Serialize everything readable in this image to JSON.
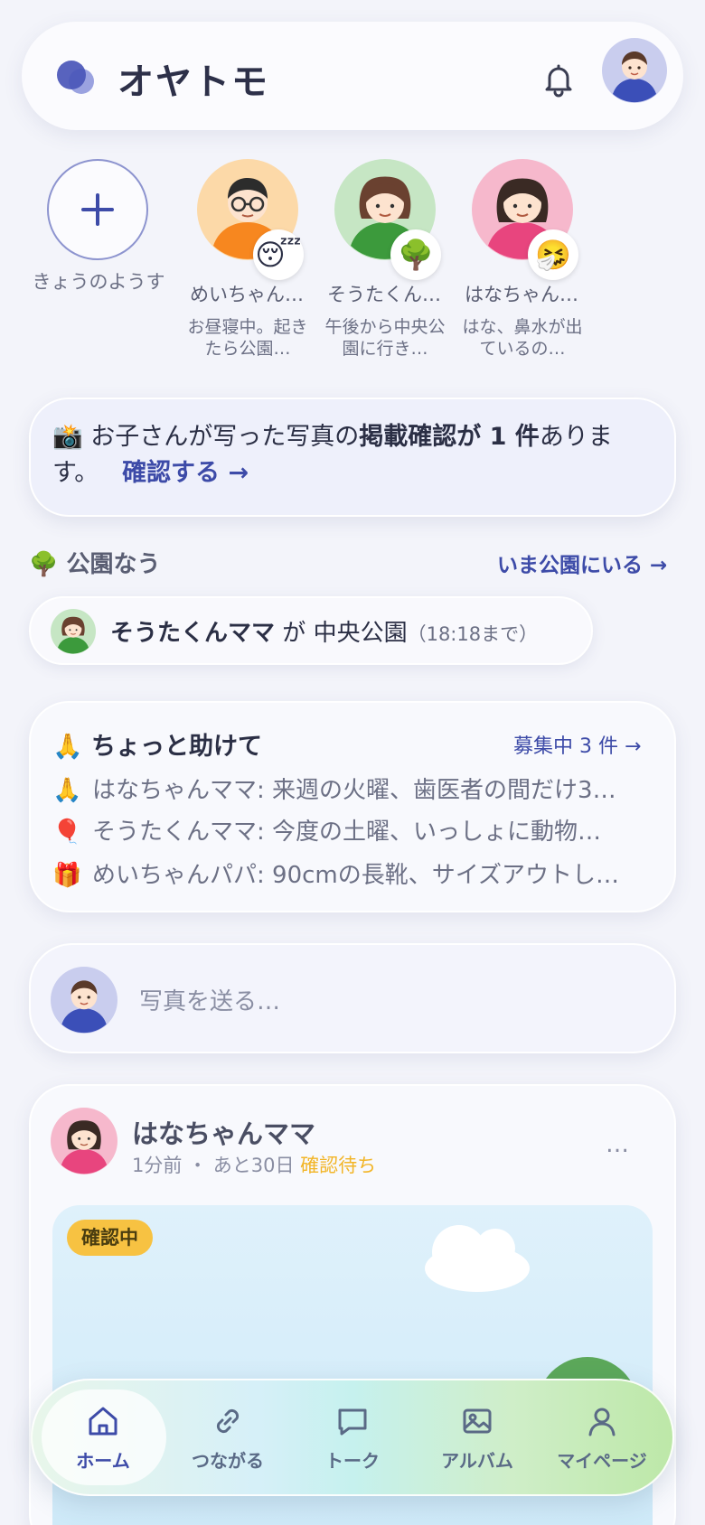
{
  "app": {
    "title": "オヤトモ",
    "accent": "#3d4ba8"
  },
  "header": {
    "bell_icon": "bell-icon",
    "avatar_icon": "user-avatar"
  },
  "stories": {
    "add_label": "きょうのようす",
    "items": [
      {
        "name": "めいちゃん…",
        "status": "😴",
        "note": "お昼寝中。起きたら公園…"
      },
      {
        "name": "そうたくん…",
        "status": "🌳",
        "note": "午後から中央公園に行き…"
      },
      {
        "name": "はなちゃん…",
        "status": "🤧",
        "note": "はな、鼻水が出ているの…"
      }
    ]
  },
  "banner": {
    "icon": "📸",
    "text_before": "お子さんが写った写真の",
    "text_bold": "掲載確認が 1 件",
    "text_after": "あります。",
    "link": "確認する →"
  },
  "park": {
    "icon": "🌳",
    "title": "公園なう",
    "link": "いま公園にいる →",
    "who": "そうたくんママ",
    "particle": "が",
    "place": "中央公園",
    "until": "（18:18まで）"
  },
  "help": {
    "icon": "🙏",
    "title": "ちょっと助けて",
    "count": "募集中 3 件 →",
    "items": [
      {
        "emoji": "🙏",
        "text": "はなちゃんママ: 来週の火曜、歯医者の間だけ3…"
      },
      {
        "emoji": "🎈",
        "text": "そうたくんママ: 今度の土曜、いっしょに動物…"
      },
      {
        "emoji": "🎁",
        "text": "めいちゃんパパ: 90cmの長靴、サイズアウトし…"
      }
    ]
  },
  "composer": {
    "placeholder": "写真を送る…"
  },
  "post": {
    "author": "はなちゃんママ",
    "time": "1分前",
    "sep": "・",
    "remaining": "あと30日",
    "pending": "確認待ち",
    "more": "…",
    "chip": "確認中"
  },
  "nav": {
    "items": [
      {
        "label": "ホーム",
        "icon": "home-icon"
      },
      {
        "label": "つながる",
        "icon": "link-icon"
      },
      {
        "label": "トーク",
        "icon": "chat-icon"
      },
      {
        "label": "アルバム",
        "icon": "album-icon"
      },
      {
        "label": "マイページ",
        "icon": "person-icon"
      }
    ]
  }
}
